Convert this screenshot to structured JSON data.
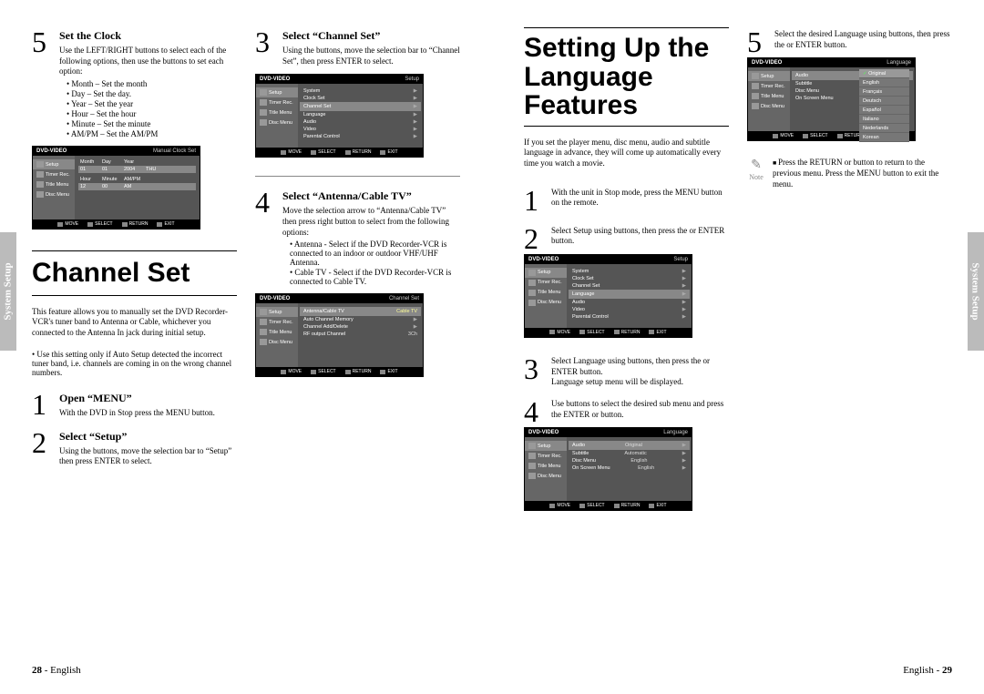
{
  "sideTab": "System Setup",
  "left": {
    "col1": {
      "step5": {
        "num": "5",
        "title": "Set the Clock",
        "text": "Use the LEFT/RIGHT buttons to select each of the following options, then use the buttons to set each option:",
        "bullets": [
          "Month – Set the month",
          "Day – Set the day.",
          "Year – Set the year",
          "Hour – Set the hour",
          "Minute – Set the minute",
          "AM/PM – Set the AM/PM"
        ]
      },
      "section": {
        "title": "Channel Set",
        "intro": "This feature allows you to manually set the DVD Recorder-VCR's tuner band to Antenna or Cable, whichever you connected to the Antenna In jack during initial setup.",
        "bullet": "Use this setting only if Auto Setup detected the incorrect tuner band, i.e. channels are coming in on the wrong channel numbers."
      },
      "step1": {
        "num": "1",
        "title": "Open “MENU”",
        "text": "With the DVD in Stop press the MENU button."
      },
      "step2": {
        "num": "2",
        "title": "Select “Setup”",
        "text": "Using the buttons, move the selection bar to “Setup” then press ENTER to select."
      }
    },
    "col2": {
      "step3": {
        "num": "3",
        "title": "Select “Channel Set”",
        "text": "Using the buttons, move the selection bar to “Channel Set”, then press ENTER to select."
      },
      "step4": {
        "num": "4",
        "title": "Select “Antenna/Cable TV”",
        "text": "Move the selection arrow to “Antenna/Cable TV” then press right button to select from the following options:",
        "bullets": [
          "Antenna - Select if the DVD Recorder-VCR is connected to an indoor or outdoor VHF/UHF Antenna.",
          "Cable TV - Select if the DVD Recorder-VCR is connected to Cable TV."
        ]
      }
    },
    "footer": {
      "page": "28",
      "lang": "English"
    },
    "osd": {
      "clock": {
        "header": "DVD-VIDEO",
        "headerRight": "Manual Clock Set",
        "sidebar": [
          "Setup",
          "Timer Rec.",
          "Title Menu",
          "Disc Menu"
        ],
        "headers": [
          "Month",
          "Day",
          "Year"
        ],
        "vals1": [
          "01",
          "01",
          "2004",
          "THU"
        ],
        "headers2": [
          "Hour",
          "Minute",
          "AM/PM"
        ],
        "vals2": [
          "12",
          "00",
          "AM"
        ],
        "footer": [
          "MOVE",
          "SELECT",
          "RETURN",
          "EXIT"
        ]
      },
      "setup": {
        "header": "DVD-VIDEO",
        "headerRight": "Setup",
        "sidebar": [
          "Setup",
          "Timer Rec.",
          "Title Menu",
          "Disc Menu"
        ],
        "rows": [
          "System",
          "Clock Set",
          "Channel Set",
          "Language",
          "Audio",
          "Video",
          "Parental Control"
        ],
        "footer": [
          "MOVE",
          "SELECT",
          "RETURN",
          "EXIT"
        ]
      },
      "channel": {
        "header": "DVD-VIDEO",
        "headerRight": "Channel Set",
        "sidebar": [
          "Setup",
          "Timer Rec.",
          "Title Menu",
          "Disc Menu"
        ],
        "rows": [
          {
            "label": "Antenna/Cable TV",
            "val": "Cable TV"
          },
          {
            "label": "Auto Channel Memory",
            "val": ""
          },
          {
            "label": "Channel Add/Delete",
            "val": ""
          },
          {
            "label": "RF output Channel",
            "val": "3Ch"
          }
        ],
        "footer": [
          "MOVE",
          "SELECT",
          "RETURN",
          "EXIT"
        ]
      }
    }
  },
  "right": {
    "section": {
      "title": "Setting Up the Language Features",
      "intro": "If you set the player menu, disc menu, audio and subtitle language in advance, they will come up automatically every time you watch a movie."
    },
    "step1": {
      "num": "1",
      "text": "With the unit in Stop mode, press the MENU button on the remote."
    },
    "step2": {
      "num": "2",
      "text": "Select Setup using buttons, then press the or ENTER button."
    },
    "step3": {
      "num": "3",
      "text1": "Select Language using buttons, then press the or ENTER button.",
      "text2": "Language setup menu will be displayed."
    },
    "step4": {
      "num": "4",
      "text": "Use buttons to select the desired sub menu and press the ENTER or button."
    },
    "step5": {
      "num": "5",
      "text": "Select the desired Language using buttons, then press the or ENTER button."
    },
    "note": {
      "label": "Note",
      "text": "Press the RETURN or button to return to the previous menu. Press the MENU button to exit the menu."
    },
    "footer": {
      "lang": "English",
      "page": "29"
    },
    "osd": {
      "lang1": {
        "header": "DVD-VIDEO",
        "headerRight": "Language",
        "sidebar": [
          "Setup",
          "Timer Rec.",
          "Title Menu",
          "Disc Menu"
        ],
        "rows": [
          {
            "label": "Audio",
            "val": "Original"
          },
          {
            "label": "Subtitle",
            "val": "Automatic"
          },
          {
            "label": "Disc Menu",
            "val": "English"
          },
          {
            "label": "On Screen Menu",
            "val": "English"
          }
        ],
        "footer": [
          "MOVE",
          "SELECT",
          "RETURN",
          "EXIT"
        ]
      },
      "lang2": {
        "header": "DVD-VIDEO",
        "headerRight": "Language",
        "sidebar": [
          "Setup",
          "Timer Rec.",
          "Title Menu",
          "Disc Menu"
        ],
        "leftRows": [
          "Audio",
          "Subtitle",
          "Disc Menu",
          "On Screen Menu"
        ],
        "submenu": [
          "Original",
          "English",
          "Français",
          "Deutsch",
          "Español",
          "Italiano",
          "Nederlands",
          "Korean"
        ],
        "footer": [
          "MOVE",
          "SELECT",
          "RETURN",
          "EXIT"
        ]
      }
    }
  }
}
